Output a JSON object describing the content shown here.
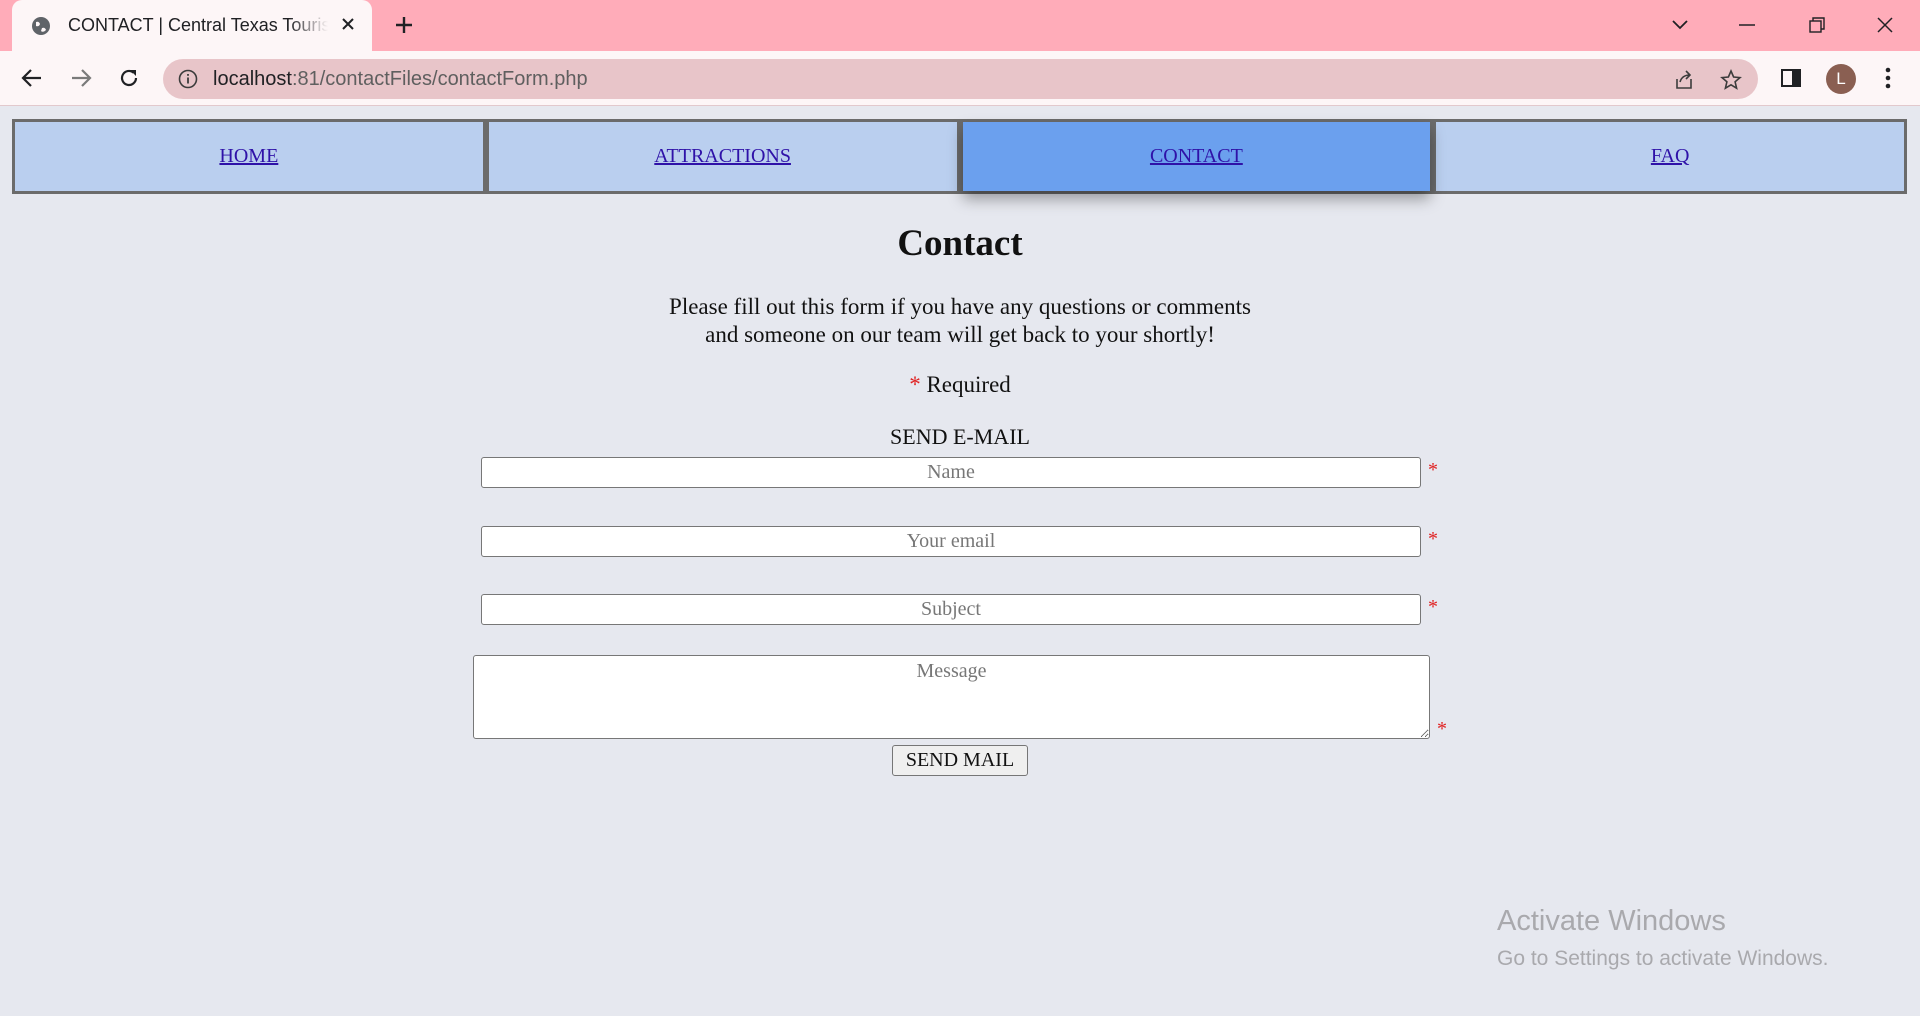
{
  "browser": {
    "tab_title": "CONTACT | Central Texas Tourism",
    "url_host": "localhost",
    "url_rest": ":81/contactFiles/contactForm.php",
    "profile_initial": "L"
  },
  "nav": {
    "items": [
      {
        "label": "HOME",
        "active": false
      },
      {
        "label": "ATTRACTIONS",
        "active": false
      },
      {
        "label": "CONTACT",
        "active": true
      },
      {
        "label": "FAQ",
        "active": false
      }
    ]
  },
  "page": {
    "heading": "Contact",
    "intro_line1": "Please fill out this form if you have any questions or comments",
    "intro_line2": "and someone on our team will get back to your shortly!",
    "required_star": "*",
    "required_label": "Required",
    "send_label": "SEND E-MAIL"
  },
  "form": {
    "name_placeholder": "Name",
    "email_placeholder": "Your email",
    "subject_placeholder": "Subject",
    "message_placeholder": "Message",
    "required_marker": "*",
    "submit_label": "SEND MAIL"
  },
  "watermark": {
    "title": "Activate Windows",
    "subtitle": "Go to Settings to activate Windows."
  },
  "colors": {
    "tabstrip": "#ffacb9",
    "nav_item": "#bacfef",
    "nav_active": "#6ba0ee",
    "page_bg": "#e6e8ef",
    "required_star": "#e02020"
  }
}
